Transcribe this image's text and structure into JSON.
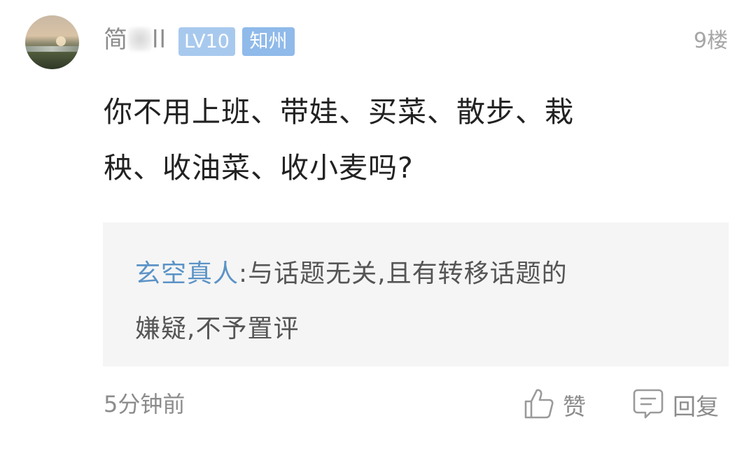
{
  "comment": {
    "username_prefix": "简",
    "username_suffix": "ll",
    "level_badge": "LV10",
    "region_badge": "知州",
    "floor": "9楼",
    "text_line1": "你不用上班、带娃、买菜、散步、栽",
    "text_line2": "秧、收油菜、收小麦吗?",
    "timestamp": "5分钟前"
  },
  "moderator_note": {
    "name": "玄空真人",
    "separator": ":",
    "text_line1": "与话题无关,且有转移话题的",
    "text_line2": "嫌疑,不予置评"
  },
  "actions": {
    "like_label": "赞",
    "reply_label": "回复",
    "like_icon": "thumbs-up-icon",
    "reply_icon": "comment-icon"
  },
  "colors": {
    "moderator_name": "#5b93c7",
    "level_badge": "#a8c9ee",
    "region_badge": "#8fbaea",
    "note_background": "#f5f5f5"
  }
}
